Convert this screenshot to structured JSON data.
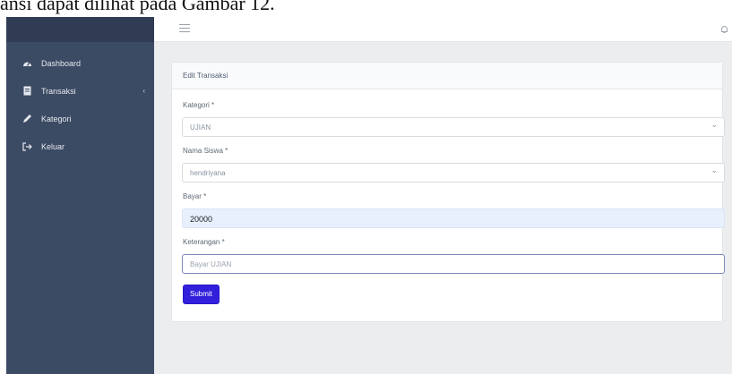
{
  "document_strip": {
    "text": "ansi dapat dilihat pada Gambar 12."
  },
  "sidebar": {
    "items": [
      {
        "label": "Dashboard",
        "icon": "speedometer-icon"
      },
      {
        "label": "Transaksi",
        "icon": "document-icon",
        "caret": "‹"
      },
      {
        "label": "Kategori",
        "icon": "pencil-icon"
      },
      {
        "label": "Keluar",
        "icon": "logout-icon"
      }
    ]
  },
  "header": {
    "menu_icon": "hamburger-icon",
    "right_icon": "bell-icon"
  },
  "card": {
    "title": "Edit Transaksi",
    "fields": {
      "kategori": {
        "label": "Kategori *",
        "value": "UJIAN"
      },
      "nama_siswa": {
        "label": "Nama Siswa *",
        "value": "hendriyana"
      },
      "bayar": {
        "label": "Bayar *",
        "value": "20000"
      },
      "keterangan": {
        "label": "Keterangan *",
        "placeholder": "Bayar UJIAN"
      }
    },
    "submit_label": "Submit"
  },
  "colors": {
    "sidebar": "#3c4b64",
    "primary": "#321fdb",
    "autofill": "#e8f0fe"
  }
}
